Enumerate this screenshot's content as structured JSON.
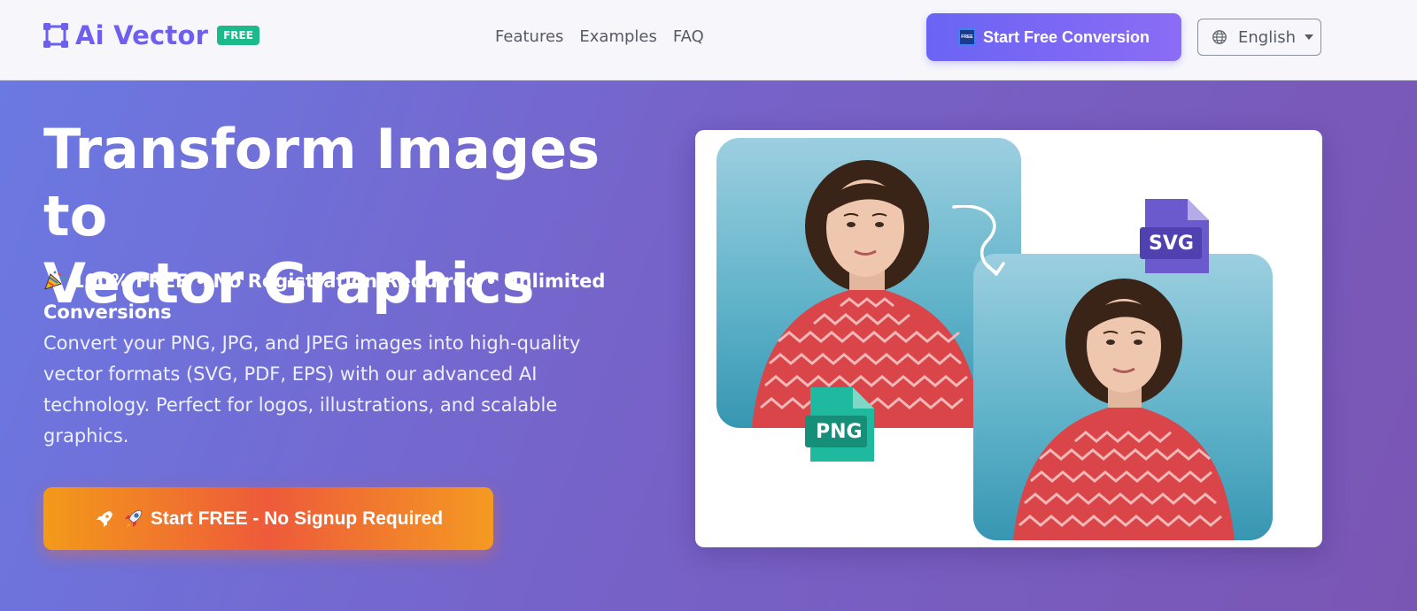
{
  "header": {
    "logo_text": "Ai Vector",
    "badge": "FREE",
    "nav": [
      "Features",
      "Examples",
      "FAQ"
    ],
    "cta_label": "Start Free Conversion",
    "cta_icon": "free-icon",
    "language": "English"
  },
  "hero": {
    "title_line1": "Transform Images to",
    "title_line2": "Vector Graphics",
    "free_line": "100% FREE • No Registration Required • Unlimited Conversions",
    "description": "Convert your PNG, JPG, and JPEG images into high-quality vector formats (SVG, PDF, EPS) with our advanced AI technology. Perfect for logos, illustrations, and scalable graphics.",
    "cta_label": "Start FREE - No Signup Required"
  },
  "demo": {
    "input_format": "PNG",
    "output_format": "SVG"
  },
  "colors": {
    "brand": "#6e5ff0",
    "free_badge": "#1cb98a",
    "png_badge": "#1fb9a0",
    "svg_badge": "#6a5acd",
    "cta_orange": "#ee5a3a"
  }
}
